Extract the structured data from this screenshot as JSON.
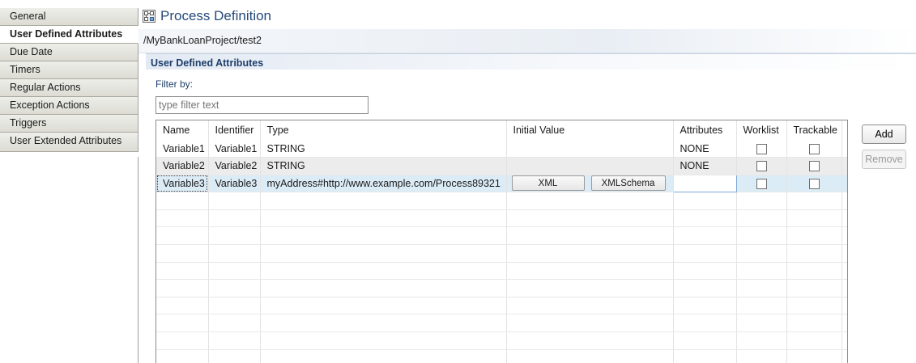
{
  "sidebar": {
    "tabs": [
      {
        "label": "General",
        "active": false
      },
      {
        "label": "User Defined Attributes",
        "active": true
      },
      {
        "label": "Due Date",
        "active": false
      },
      {
        "label": "Timers",
        "active": false
      },
      {
        "label": "Regular Actions",
        "active": false
      },
      {
        "label": "Exception Actions",
        "active": false
      },
      {
        "label": "Triggers",
        "active": false
      },
      {
        "label": "User Extended Attributes",
        "active": false
      }
    ]
  },
  "header": {
    "title": "Process Definition",
    "path": "/MyBankLoanProject/test2",
    "icon": "process-definition-icon"
  },
  "section": {
    "title": "User Defined Attributes",
    "filter_label": "Filter by:",
    "filter_placeholder": "type filter text"
  },
  "table": {
    "columns": [
      "Name",
      "Identifier",
      "Type",
      "Initial Value",
      "Attributes",
      "Worklist",
      "Trackable"
    ],
    "rows": [
      {
        "name": "Variable1",
        "identifier": "Variable1",
        "type": "STRING",
        "initial_value": "",
        "attributes": "NONE",
        "worklist": false,
        "trackable": false
      },
      {
        "name": "Variable2",
        "identifier": "Variable2",
        "type": "STRING",
        "initial_value": "",
        "attributes": "NONE",
        "worklist": false,
        "trackable": false
      },
      {
        "name": "Variable3",
        "identifier": "Variable3",
        "type": "myAddress#http://www.example.com/Process89321",
        "initial_value": "",
        "attributes": "",
        "worklist": false,
        "trackable": false
      }
    ],
    "xml_button": "XML",
    "xmlschema_button": "XMLSchema"
  },
  "buttons": {
    "add": "Add",
    "remove": "Remove"
  },
  "colors": {
    "title": "#254a7a",
    "section_title": "#1d3e6a",
    "selected_row": "#dcecf7",
    "alt_row": "#ececec"
  }
}
